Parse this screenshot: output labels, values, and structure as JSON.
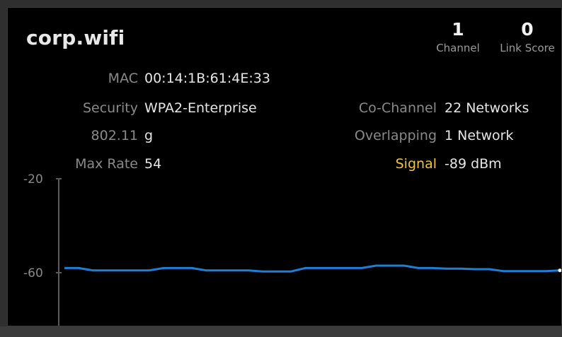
{
  "network": {
    "ssid": "corp.wifi",
    "channel": {
      "value": "1",
      "label": "Channel"
    },
    "link_score": {
      "value": "0",
      "label": "Link Score"
    }
  },
  "details_left": [
    {
      "key": "MAC",
      "value": "00:14:1B:61:4E:33"
    },
    {
      "key": "Security",
      "value": "WPA2-Enterprise"
    },
    {
      "key": "802.11",
      "value": "g"
    },
    {
      "key": "Max Rate",
      "value": "54"
    }
  ],
  "details_right": [
    {
      "key": "Co-Channel",
      "value": "22 Networks"
    },
    {
      "key": "Overlapping",
      "value": "1 Network"
    },
    {
      "key": "Signal",
      "value": "-89 dBm"
    }
  ],
  "colors": {
    "signal_label": "#f0c53a",
    "line": "#1e7fd8",
    "background": "#000000"
  },
  "chart_data": {
    "type": "line",
    "y_ticks": [
      "-20",
      "-60"
    ],
    "y_tick_values": [
      -20,
      -60
    ],
    "series": [
      {
        "values": [
          -58,
          -58,
          -59,
          -59,
          -59,
          -59,
          -59,
          -58,
          -58,
          -58,
          -59,
          -59,
          -59,
          -59,
          -59.5,
          -59.5,
          -59.5,
          -58,
          -58,
          -58,
          -58,
          -58,
          -57,
          -57,
          -57,
          -58,
          -58,
          -58.3,
          -58.3,
          -58.5,
          -58.5,
          -59.3,
          -59.3,
          -59.3,
          -59.3,
          -59
        ]
      }
    ]
  }
}
